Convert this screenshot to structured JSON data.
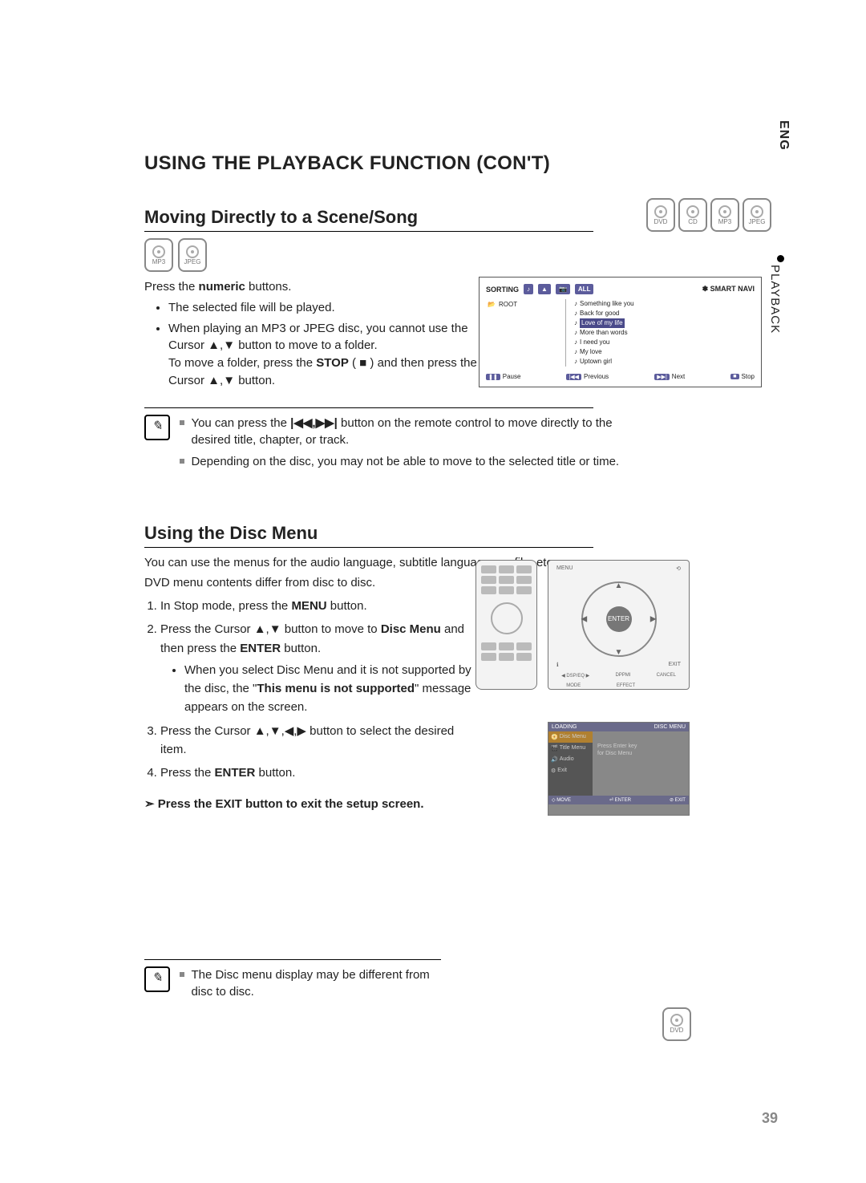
{
  "side": {
    "lang": "ENG",
    "section": "PLAYBACK"
  },
  "title": "USING THE PLAYBACK FUNCTION (CON'T)",
  "section1": {
    "heading": "Moving Directly to a Scene/Song",
    "badges": [
      "MP3",
      "JPEG"
    ],
    "press_line_a": "Press the ",
    "press_line_b": "numeric",
    "press_line_c": " buttons.",
    "bullets": [
      "The selected file will be played.",
      "When playing an MP3 or JPEG disc, you cannot use the Cursor ▲,▼ button to move to a folder."
    ],
    "tomove_a": "To move a folder, press the ",
    "tomove_b": "STOP",
    "tomove_c": " (  ■  ) and then press the Cursor ▲,▼ button.",
    "screenshot": {
      "sorting": "SORTING",
      "tabs_icons": [
        "♪",
        "▲",
        "📷",
        "ALL"
      ],
      "smart_navi": "✽ SMART NAVI",
      "root": "ROOT",
      "items": [
        "Something like you",
        "Back for good",
        "Love of my life",
        "More than words",
        "I need you",
        "My love",
        "Uptown girl"
      ],
      "selected_index": 2,
      "footer": {
        "pause": "Pause",
        "prev": "Previous",
        "next": "Next",
        "stop": "Stop"
      }
    },
    "note1_a": "You can press the ",
    "note1_skip": "|◀◀,▶▶|",
    "note1_b": " button on the remote control to move directly to the desired title, chapter, or track.",
    "note2": "Depending on the disc, you may not be able to move to the selected title or time."
  },
  "top_badges": [
    "DVD",
    "CD",
    "MP3",
    "JPEG"
  ],
  "section2": {
    "heading": "Using the Disc Menu",
    "badge": "DVD",
    "intro1": "You can use the menus for the audio language, subtitle language, profile, etc.",
    "intro2": "DVD menu contents differ from disc to disc.",
    "step1_a": "In Stop mode, press the ",
    "step1_b": "MENU",
    "step1_c": " button.",
    "step2_a": "Press the Cursor ▲,▼ button to move to ",
    "step2_b": "Disc Menu",
    "step2_c": " and then press the ",
    "step2_d": "ENTER",
    "step2_e": " button.",
    "step2_sub_a": "When you select Disc Menu and it is not supported by the disc, the \"",
    "step2_sub_b": "This menu is not supported",
    "step2_sub_c": "\" message appears on the screen.",
    "step3": "Press the Cursor ▲,▼,◀,▶ button to select the desired item.",
    "step4_a": "Press the ",
    "step4_b": "ENTER",
    "step4_c": " button.",
    "exit": "Press the EXIT button to exit the setup screen.",
    "controls": {
      "enter": "ENTER",
      "bottom": [
        "◀ DSP/EQ ▶",
        "DPPMI",
        "CANCEL",
        "MODE",
        "EFFECT"
      ]
    },
    "menu_shot": {
      "title_left": "LOADING",
      "title_right": "DISC MENU",
      "side_items": [
        "Disc Menu",
        "Title Menu",
        "Audio",
        "Exit"
      ],
      "main1": "Press Enter key",
      "main2": "for Disc Menu",
      "footer": {
        "move": "MOVE",
        "enter": "ENTER",
        "exit": "EXIT"
      }
    },
    "note": "The Disc menu display may be different from disc to disc."
  },
  "page_number": "39"
}
